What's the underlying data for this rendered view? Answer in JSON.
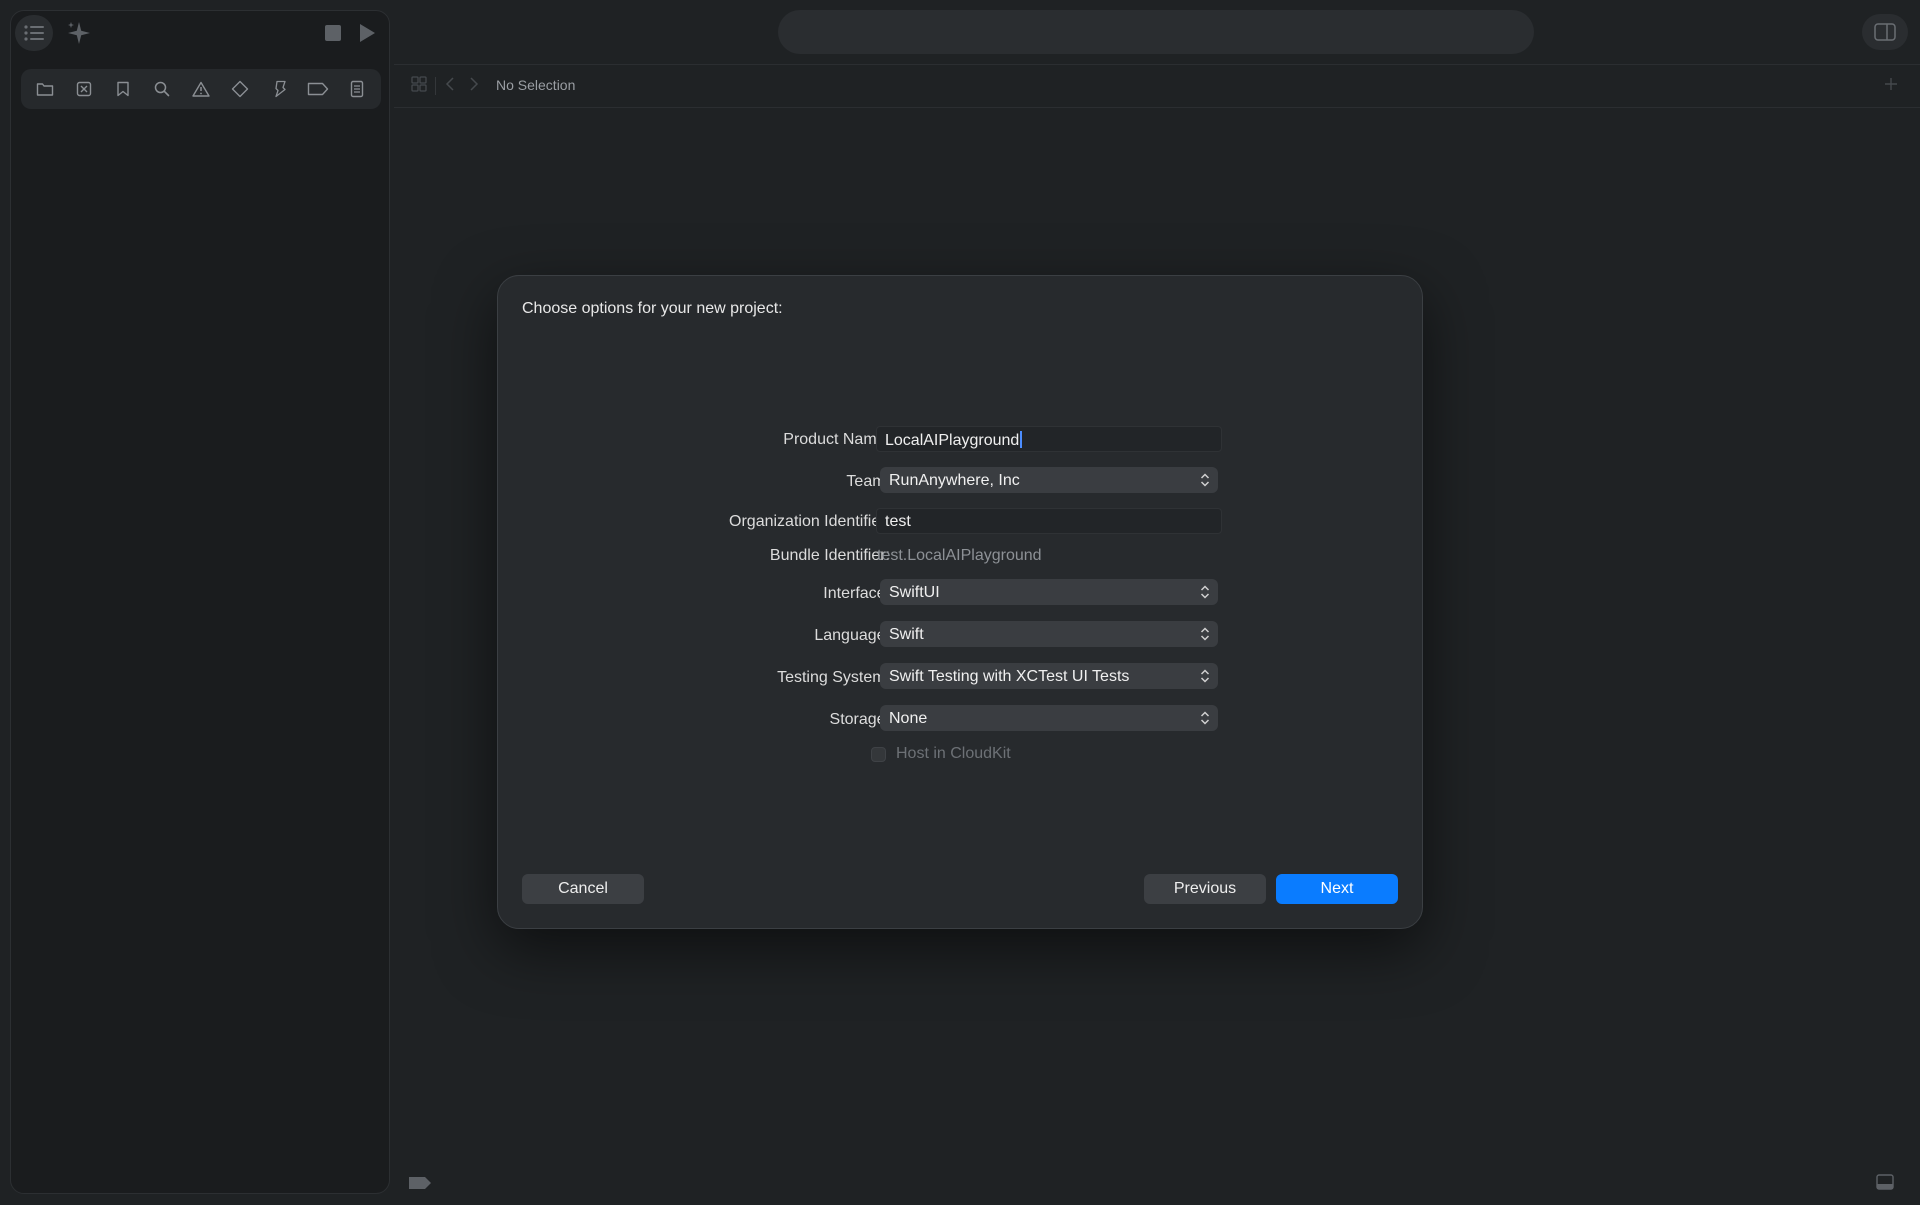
{
  "editor": {
    "breadcrumb": "No Selection"
  },
  "dialog": {
    "title": "Choose options for your new project:",
    "fields": {
      "product_name": {
        "label": "Product Name:",
        "value": "LocalAIPlayground"
      },
      "team": {
        "label": "Team:",
        "value": "RunAnywhere, Inc"
      },
      "organization_identifier": {
        "label": "Organization Identifier:",
        "value": "test"
      },
      "bundle_identifier": {
        "label": "Bundle Identifier:",
        "value": "test.LocalAIPlayground"
      },
      "interface": {
        "label": "Interface:",
        "value": "SwiftUI"
      },
      "language": {
        "label": "Language:",
        "value": "Swift"
      },
      "testing_system": {
        "label": "Testing System:",
        "value": "Swift Testing with XCTest UI Tests"
      },
      "storage": {
        "label": "Storage:",
        "value": "None"
      },
      "host_in_cloudkit": {
        "label": "Host in CloudKit",
        "checked": false,
        "enabled": false
      }
    },
    "buttons": {
      "cancel": "Cancel",
      "previous": "Previous",
      "next": "Next"
    }
  },
  "icons": {
    "navigator_toggle": "list-icon",
    "assistant": "sparkle-icon",
    "stop": "stop-icon",
    "run": "play-icon",
    "navigator_tabs": [
      "folder-icon",
      "source-control-icon",
      "bookmark-icon",
      "search-icon",
      "warning-icon",
      "test-icon",
      "debug-icon",
      "breakpoint-icon",
      "report-icon"
    ],
    "inspector_toggle": "inspector-icon",
    "popup_indicator": "chevron-updown-icon"
  },
  "colors": {
    "window_background": "#1f2224",
    "sheet_background": "#272a2d",
    "accent": "#0a7cff"
  }
}
